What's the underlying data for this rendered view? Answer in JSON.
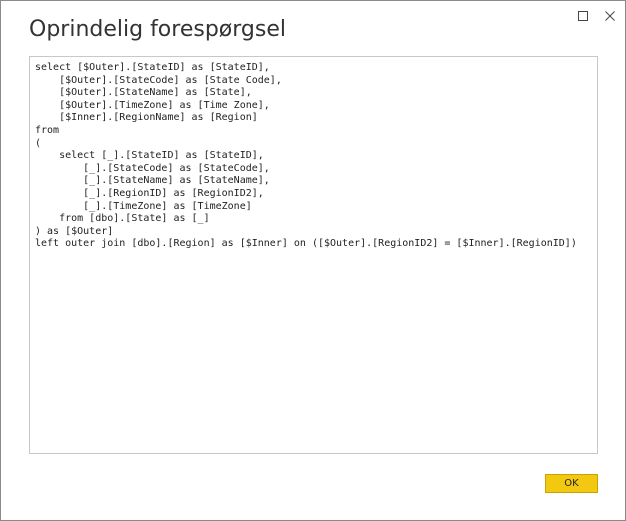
{
  "dialog": {
    "title": "Oprindelig forespørgsel",
    "ok_label": "OK",
    "accent_color": "#f2c811"
  },
  "window_controls": {
    "maximize_icon": "maximize-icon",
    "close_icon": "close-icon"
  },
  "query": {
    "lines": [
      "select [$Outer].[StateID] as [StateID],",
      "    [$Outer].[StateCode] as [State Code],",
      "    [$Outer].[StateName] as [State],",
      "    [$Outer].[TimeZone] as [Time Zone],",
      "    [$Inner].[RegionName] as [Region]",
      "from",
      "(",
      "    select [_].[StateID] as [StateID],",
      "        [_].[StateCode] as [StateCode],",
      "        [_].[StateName] as [StateName],",
      "        [_].[RegionID] as [RegionID2],",
      "        [_].[TimeZone] as [TimeZone]",
      "    from [dbo].[State] as [_]",
      ") as [$Outer]",
      "left outer join [dbo].[Region] as [$Inner] on ([$Outer].[RegionID2] = [$Inner].[RegionID])"
    ]
  }
}
